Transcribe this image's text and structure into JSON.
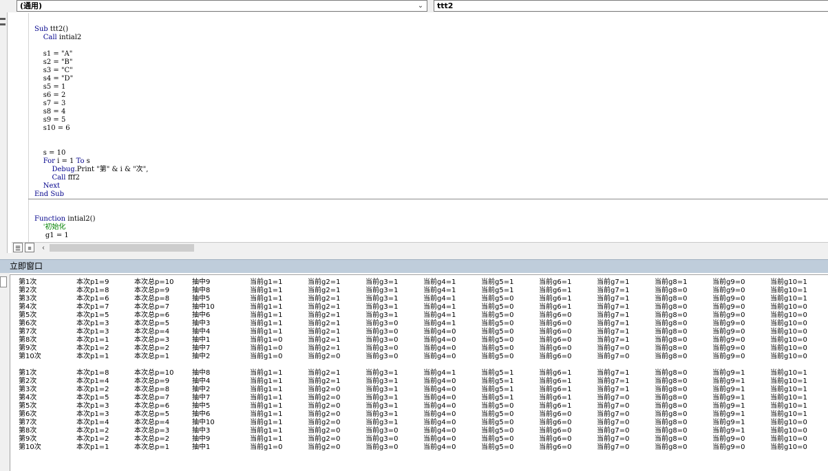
{
  "window": {
    "object_combo": "(通用)",
    "procedure_combo": "ttt2"
  },
  "code": {
    "lines": [
      "Sub ttt2()",
      "    Call intial2",
      "",
      "    s1 = \"A\"",
      "    s2 = \"B\"",
      "    s3 = \"C\"",
      "    s4 = \"D\"",
      "    s5 = 1",
      "    s6 = 2",
      "    s7 = 3",
      "    s8 = 4",
      "    s9 = 5",
      "    s10 = 6",
      "",
      "",
      "    s = 10",
      "    For i = 1 To s",
      "        Debug.Print \"第\" & i & \"次\",",
      "        Call fff2",
      "    Next",
      "End Sub",
      "",
      "",
      "Function intial2()",
      "    '初始化",
      "     g1 = 1"
    ]
  },
  "immediate": {
    "title": "立即窗口",
    "blocks": [
      [
        [
          "第1次",
          "本次p1=9",
          "本次总p=10",
          "抽中9",
          "当前g1=1",
          "当前g2=1",
          "当前g3=1",
          "当前g4=1",
          "当前g5=1",
          "当前g6=1",
          "当前g7=1",
          "当前g8=1",
          "当前g9=0",
          "当前g10=1"
        ],
        [
          "第2次",
          "本次p1=8",
          "本次总p=9",
          "抽中8",
          "当前g1=1",
          "当前g2=1",
          "当前g3=1",
          "当前g4=1",
          "当前g5=1",
          "当前g6=1",
          "当前g7=1",
          "当前g8=0",
          "当前g9=0",
          "当前g10=1"
        ],
        [
          "第3次",
          "本次p1=6",
          "本次总p=8",
          "抽中5",
          "当前g1=1",
          "当前g2=1",
          "当前g3=1",
          "当前g4=1",
          "当前g5=0",
          "当前g6=1",
          "当前g7=1",
          "当前g8=0",
          "当前g9=0",
          "当前g10=1"
        ],
        [
          "第4次",
          "本次p1=7",
          "本次总p=7",
          "抽中10",
          "当前g1=1",
          "当前g2=1",
          "当前g3=1",
          "当前g4=1",
          "当前g5=0",
          "当前g6=1",
          "当前g7=1",
          "当前g8=0",
          "当前g9=0",
          "当前g10=0"
        ],
        [
          "第5次",
          "本次p1=5",
          "本次总p=6",
          "抽中6",
          "当前g1=1",
          "当前g2=1",
          "当前g3=1",
          "当前g4=1",
          "当前g5=0",
          "当前g6=0",
          "当前g7=1",
          "当前g8=0",
          "当前g9=0",
          "当前g10=0"
        ],
        [
          "第6次",
          "本次p1=3",
          "本次总p=5",
          "抽中3",
          "当前g1=1",
          "当前g2=1",
          "当前g3=0",
          "当前g4=1",
          "当前g5=0",
          "当前g6=0",
          "当前g7=1",
          "当前g8=0",
          "当前g9=0",
          "当前g10=0"
        ],
        [
          "第7次",
          "本次p1=3",
          "本次总p=4",
          "抽中4",
          "当前g1=1",
          "当前g2=1",
          "当前g3=0",
          "当前g4=0",
          "当前g5=0",
          "当前g6=0",
          "当前g7=1",
          "当前g8=0",
          "当前g9=0",
          "当前g10=0"
        ],
        [
          "第8次",
          "本次p1=1",
          "本次总p=3",
          "抽中1",
          "当前g1=0",
          "当前g2=1",
          "当前g3=0",
          "当前g4=0",
          "当前g5=0",
          "当前g6=0",
          "当前g7=1",
          "当前g8=0",
          "当前g9=0",
          "当前g10=0"
        ],
        [
          "第9次",
          "本次p1=2",
          "本次总p=2",
          "抽中7",
          "当前g1=0",
          "当前g2=1",
          "当前g3=0",
          "当前g4=0",
          "当前g5=0",
          "当前g6=0",
          "当前g7=0",
          "当前g8=0",
          "当前g9=0",
          "当前g10=0"
        ],
        [
          "第10次",
          "本次p1=1",
          "本次总p=1",
          "抽中2",
          "当前g1=0",
          "当前g2=0",
          "当前g3=0",
          "当前g4=0",
          "当前g5=0",
          "当前g6=0",
          "当前g7=0",
          "当前g8=0",
          "当前g9=0",
          "当前g10=0"
        ]
      ],
      [
        [
          "第1次",
          "本次p1=8",
          "本次总p=10",
          "抽中8",
          "当前g1=1",
          "当前g2=1",
          "当前g3=1",
          "当前g4=1",
          "当前g5=1",
          "当前g6=1",
          "当前g7=1",
          "当前g8=0",
          "当前g9=1",
          "当前g10=1"
        ],
        [
          "第2次",
          "本次p1=4",
          "本次总p=9",
          "抽中4",
          "当前g1=1",
          "当前g2=1",
          "当前g3=1",
          "当前g4=0",
          "当前g5=1",
          "当前g6=1",
          "当前g7=1",
          "当前g8=0",
          "当前g9=1",
          "当前g10=1"
        ],
        [
          "第3次",
          "本次p1=2",
          "本次总p=8",
          "抽中2",
          "当前g1=1",
          "当前g2=0",
          "当前g3=1",
          "当前g4=0",
          "当前g5=1",
          "当前g6=1",
          "当前g7=1",
          "当前g8=0",
          "当前g9=1",
          "当前g10=1"
        ],
        [
          "第4次",
          "本次p1=5",
          "本次总p=7",
          "抽中7",
          "当前g1=1",
          "当前g2=0",
          "当前g3=1",
          "当前g4=0",
          "当前g5=1",
          "当前g6=1",
          "当前g7=0",
          "当前g8=0",
          "当前g9=1",
          "当前g10=1"
        ],
        [
          "第5次",
          "本次p1=3",
          "本次总p=6",
          "抽中5",
          "当前g1=1",
          "当前g2=0",
          "当前g3=1",
          "当前g4=0",
          "当前g5=0",
          "当前g6=1",
          "当前g7=0",
          "当前g8=0",
          "当前g9=1",
          "当前g10=1"
        ],
        [
          "第6次",
          "本次p1=3",
          "本次总p=5",
          "抽中6",
          "当前g1=1",
          "当前g2=0",
          "当前g3=1",
          "当前g4=0",
          "当前g5=0",
          "当前g6=0",
          "当前g7=0",
          "当前g8=0",
          "当前g9=1",
          "当前g10=1"
        ],
        [
          "第7次",
          "本次p1=4",
          "本次总p=4",
          "抽中10",
          "当前g1=1",
          "当前g2=0",
          "当前g3=1",
          "当前g4=0",
          "当前g5=0",
          "当前g6=0",
          "当前g7=0",
          "当前g8=0",
          "当前g9=1",
          "当前g10=0"
        ],
        [
          "第8次",
          "本次p1=2",
          "本次总p=3",
          "抽中3",
          "当前g1=1",
          "当前g2=0",
          "当前g3=0",
          "当前g4=0",
          "当前g5=0",
          "当前g6=0",
          "当前g7=0",
          "当前g8=0",
          "当前g9=1",
          "当前g10=0"
        ],
        [
          "第9次",
          "本次p1=2",
          "本次总p=2",
          "抽中9",
          "当前g1=1",
          "当前g2=0",
          "当前g3=0",
          "当前g4=0",
          "当前g5=0",
          "当前g6=0",
          "当前g7=0",
          "当前g8=0",
          "当前g9=0",
          "当前g10=0"
        ],
        [
          "第10次",
          "本次p1=1",
          "本次总p=1",
          "抽中1",
          "当前g1=0",
          "当前g2=0",
          "当前g3=0",
          "当前g4=0",
          "当前g5=0",
          "当前g6=0",
          "当前g7=0",
          "当前g8=0",
          "当前g9=0",
          "当前g10=0"
        ]
      ]
    ]
  }
}
